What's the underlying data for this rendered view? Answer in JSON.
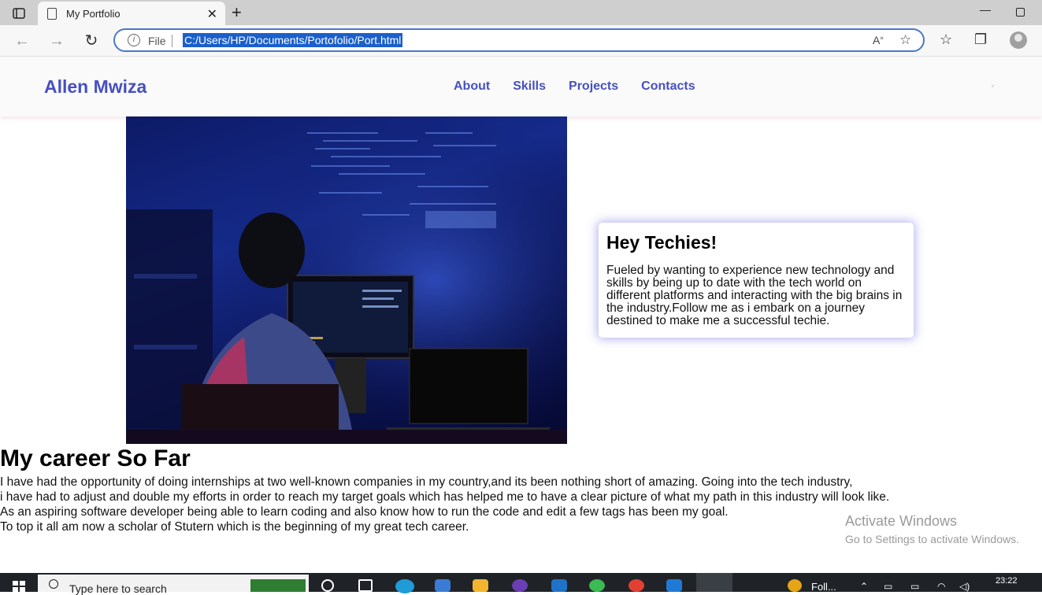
{
  "browser": {
    "tab_title": "My Portfolio",
    "address_scheme_label": "File",
    "address_url": "C:/Users/HP/Documents/Portofolio/Port.html"
  },
  "site": {
    "brand": "Allen Mwiza",
    "menu": [
      "About",
      "Skills",
      "Projects",
      "Contacts"
    ],
    "card": {
      "title": "Hey Techies!",
      "body": "Fueled by wanting to experience new technology and skills by being up to date with the tech world on different platforms and interacting with the big brains in the industry.Follow me as i embark on a journey destined to make me a successful techie."
    },
    "career": {
      "title": "My career So Far",
      "lines": [
        "I have had the opportunity of doing internships at two well-known companies in my country,and its been nothing short of amazing. Going into the tech industry,",
        "i have had to adjust and double my efforts in order to reach my target goals which has helped me to have a clear picture of what my path in this industry will look like.",
        "As an aspiring software developer being able to learn coding and also know how to run the code and edit a few tags has been my goal.",
        "To top it all am now a scholar of Stutern which is the beginning of my great tech career."
      ]
    }
  },
  "watermark": {
    "line1": "Activate Windows",
    "line2": "Go to Settings to activate Windows."
  },
  "taskbar": {
    "search_placeholder": "Type here to search",
    "app_label": "Foll...",
    "time": "23:22"
  },
  "colors": {
    "brand": "#4650c0",
    "url_highlight": "#1a5fcc",
    "card_glow": "#6e6ee6"
  }
}
